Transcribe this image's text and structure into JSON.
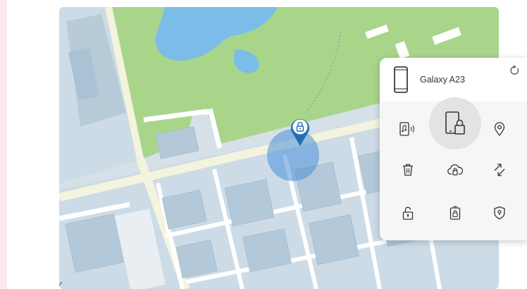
{
  "device": {
    "name": "Galaxy A23"
  },
  "actions": [
    {
      "icon": "ring-icon"
    },
    {
      "icon": "lock-icon"
    },
    {
      "icon": "track-location-icon"
    },
    {
      "icon": "erase-data-icon"
    },
    {
      "icon": "backup-icon"
    },
    {
      "icon": "extend-battery-icon"
    },
    {
      "icon": "unlock-icon"
    },
    {
      "icon": "retrieve-calls-messages-icon"
    },
    {
      "icon": "guardians-icon"
    }
  ],
  "colors": {
    "park": "#a9d58b",
    "water": "#7bbde8",
    "streets": "#f1f2e0",
    "blocks": "#c6d9e5",
    "accent": "#1f6fb8"
  }
}
